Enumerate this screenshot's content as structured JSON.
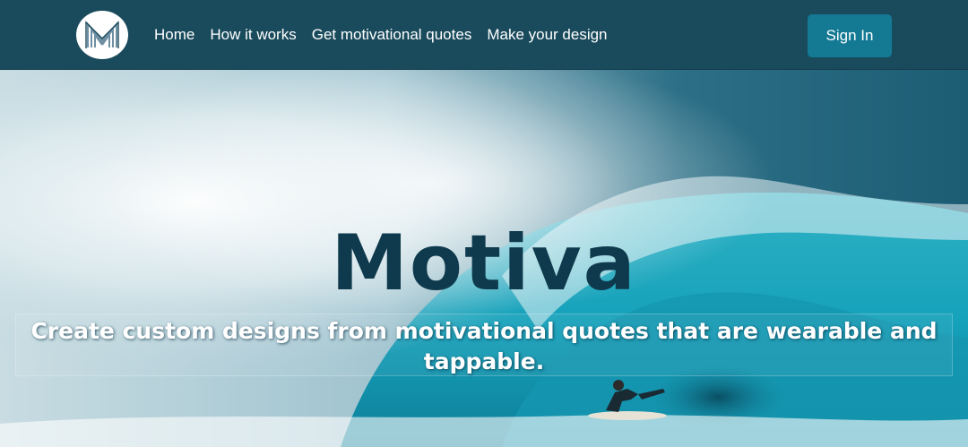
{
  "nav": {
    "logo_letter": "M",
    "links": [
      {
        "label": "Home"
      },
      {
        "label": "How it works"
      },
      {
        "label": "Get motivational quotes"
      },
      {
        "label": "Make your design"
      }
    ],
    "signin_label": "Sign In"
  },
  "hero": {
    "title": "Motiva",
    "tagline": "Create custom designs from motivational quotes that are wearable and tappable."
  },
  "colors": {
    "navbar": "#1a4b5c",
    "signin_button": "#147a94",
    "title": "#0f3a4d"
  }
}
